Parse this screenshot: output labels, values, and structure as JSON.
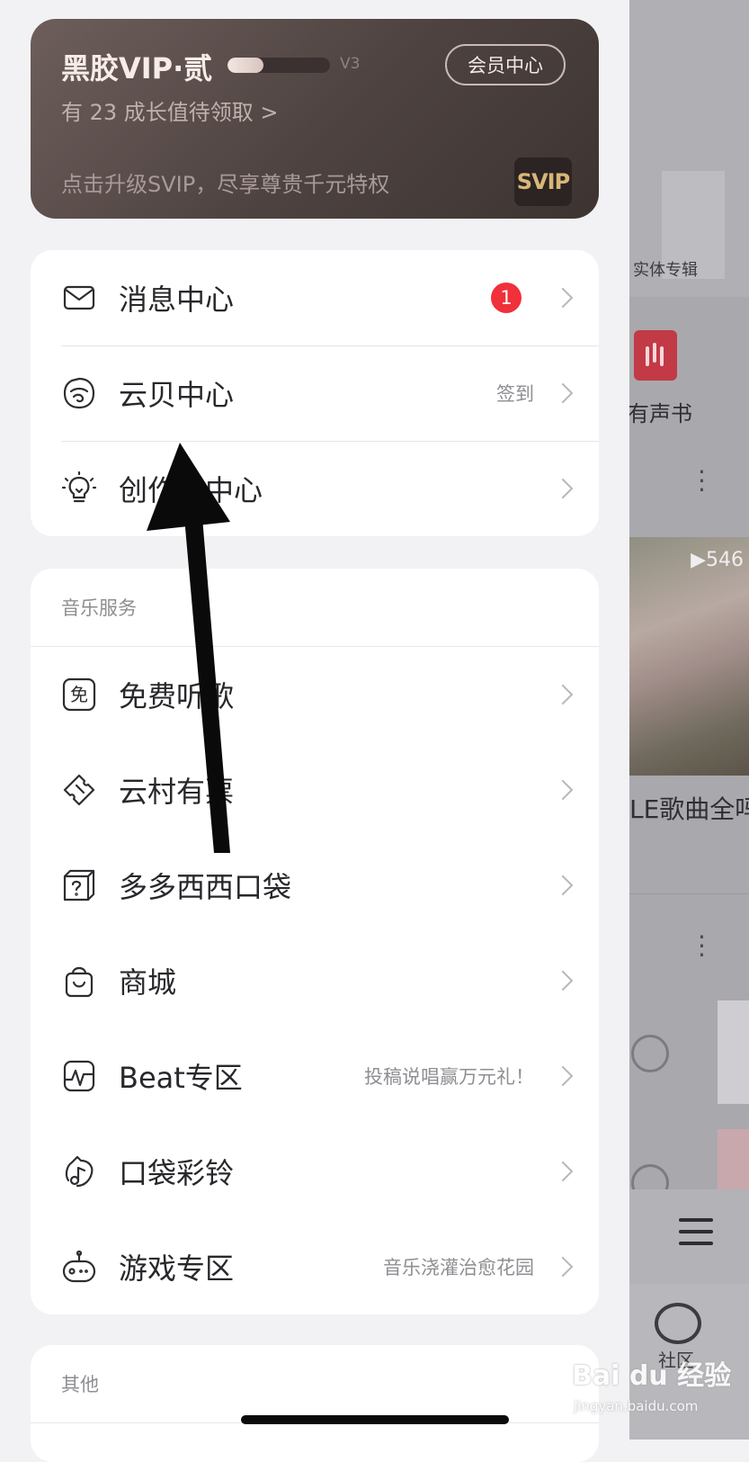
{
  "vip_card": {
    "title": "黑胶VIP·贰",
    "level": "V3",
    "progress": 0.35,
    "center_button": "会员中心",
    "growth_text": "有 23 成长值待领取 >",
    "upgrade_text": "点击升级SVIP，尽享尊贵千元特权",
    "svip_logo_text": "SVIP"
  },
  "account_menu": [
    {
      "label": "消息中心",
      "icon": "mail-icon",
      "badge": "1"
    },
    {
      "label": "云贝中心",
      "icon": "cloud-shell-icon",
      "extra": "签到"
    },
    {
      "label": "创作者中心",
      "icon": "lightbulb-icon"
    }
  ],
  "music_services": {
    "heading": "音乐服务",
    "items": [
      {
        "label": "免费听歌",
        "icon": "free-listen-icon",
        "extra": ""
      },
      {
        "label": "云村有票",
        "icon": "ticket-icon",
        "extra": ""
      },
      {
        "label": "多多西西口袋",
        "icon": "mystery-box-icon",
        "extra": ""
      },
      {
        "label": "商城",
        "icon": "shopping-bag-icon",
        "extra": ""
      },
      {
        "label": "Beat专区",
        "icon": "beat-wave-icon",
        "extra": "投稿说唱赢万元礼！"
      },
      {
        "label": "口袋彩铃",
        "icon": "ringtone-icon",
        "extra": ""
      },
      {
        "label": "游戏专区",
        "icon": "game-controller-icon",
        "extra": "音乐浇灌治愈花园"
      }
    ]
  },
  "other_section": {
    "heading": "其他"
  },
  "background": {
    "album_label": "实体专辑",
    "audiobook_label": "有声书",
    "photo_count": "▶546",
    "song_title": "LE歌曲全吗",
    "community_label": "社区"
  },
  "watermark": {
    "main": "Bai du 经验",
    "sub": "jingyan.baidu.com"
  },
  "colors": {
    "badge": "#f0303b",
    "vip_card": "#5a4c49",
    "svip_gold": "#d9b676"
  }
}
